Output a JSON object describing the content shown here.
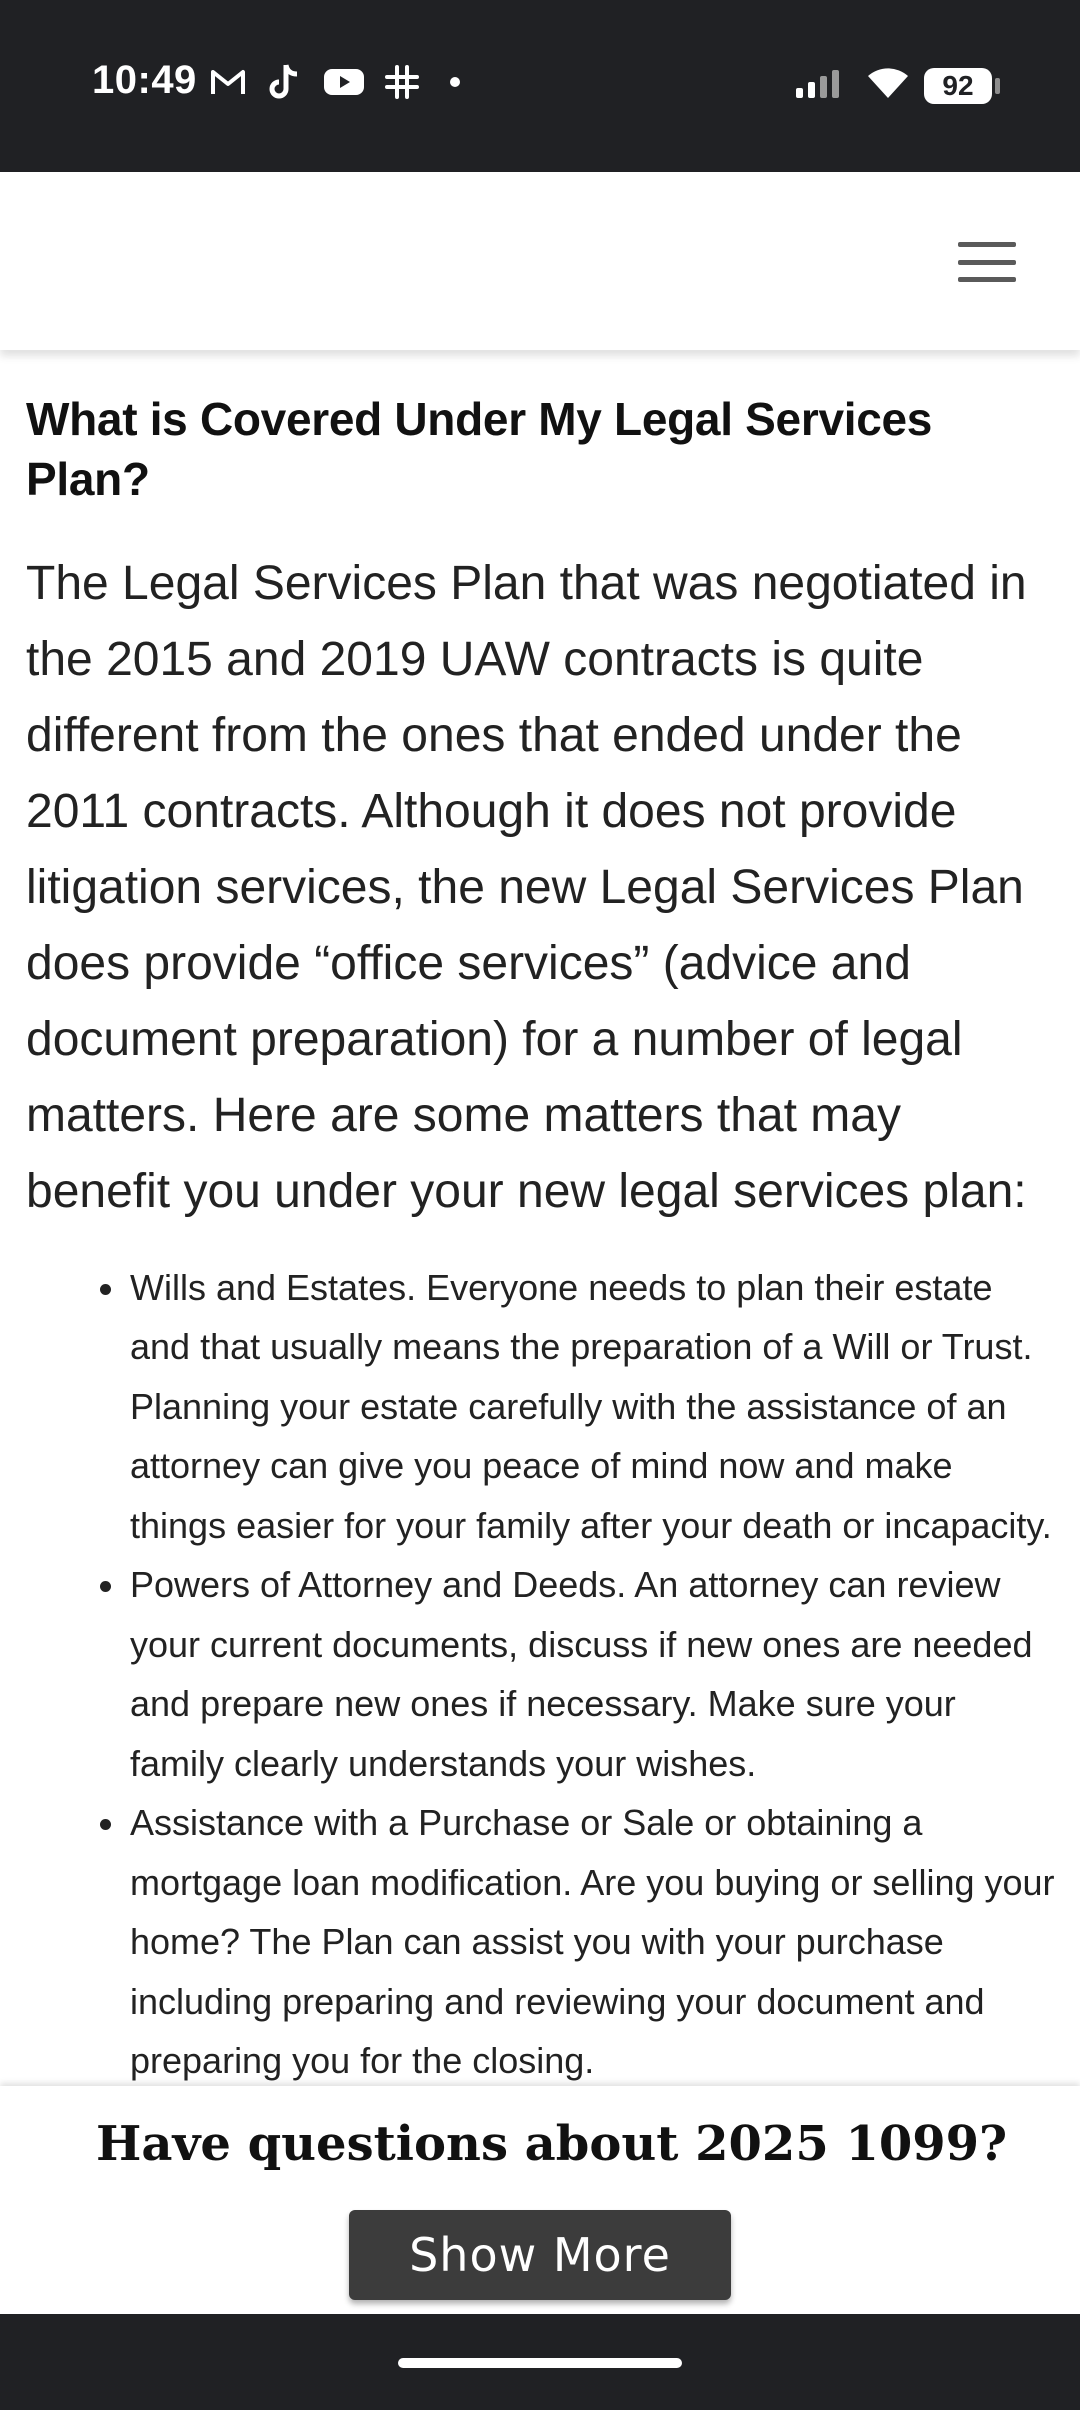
{
  "status_bar": {
    "time": "10:49",
    "battery": "92",
    "left_icons": [
      "gmail-icon",
      "tiktok-icon",
      "youtube-icon",
      "slack-icon"
    ],
    "right_icons": [
      "signal-icon",
      "wifi-icon",
      "battery-icon"
    ]
  },
  "header": {
    "menu_icon": "hamburger-menu-icon"
  },
  "article": {
    "heading": "What is Covered Under My Legal Services Plan?",
    "intro": "The Legal Services Plan that was negotiated in the 2015 and 2019 UAW contracts is quite different from the ones that ended under the 2011 contracts. Although it does not provide litigation services, the new Legal Services Plan does provide “office services” (advice and document preparation) for a number of legal matters. Here are some matters that may benefit you under your new legal services plan:",
    "items": [
      "Wills and Estates. Everyone needs to plan their estate and that usually means the preparation of a Will or Trust. Planning your estate carefully with the assistance of an attorney can give you peace of mind now and make things easier for your family after your death or incapacity.",
      "Powers of Attorney and Deeds. An attorney can review your current documents, discuss if new ones are needed and prepare new ones if necessary. Make sure your family clearly understands your wishes.",
      "Assistance with a Purchase or Sale or obtaining a mortgage loan modification. Are you buying or selling your home? The Plan can assist you with your purchase including preparing and reviewing your document and preparing you for the closing."
    ]
  },
  "banner": {
    "title": "Have questions about 2025 1099?",
    "button_label": "Show More"
  }
}
